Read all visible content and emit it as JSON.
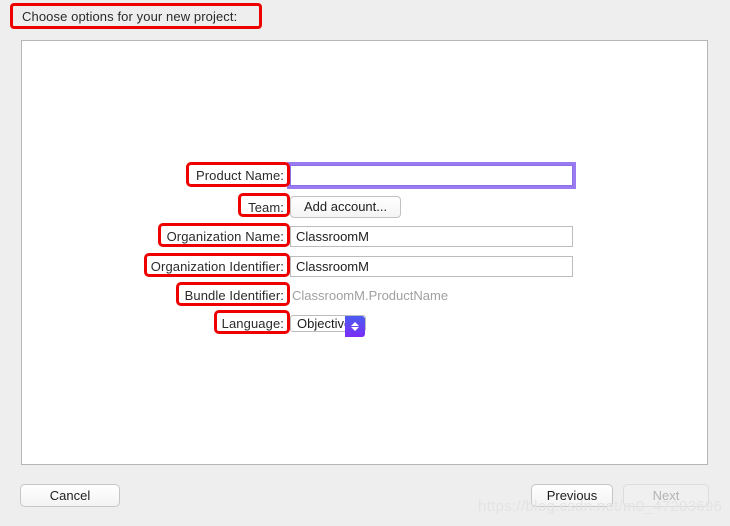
{
  "dialog": {
    "title": "Choose options for your new project:"
  },
  "form": {
    "rows": [
      {
        "label": "Product Name:",
        "type": "text",
        "value": "",
        "placeholder": "",
        "focused": true
      },
      {
        "label": "Team:",
        "type": "button",
        "value": "Add account..."
      },
      {
        "label": "Organization Name:",
        "type": "text",
        "value": "ClassroomM",
        "placeholder": "",
        "focused": false
      },
      {
        "label": "Organization Identifier:",
        "type": "text",
        "value": "ClassroomM",
        "placeholder": "",
        "focused": false
      },
      {
        "label": "Bundle Identifier:",
        "type": "static",
        "value": "ClassroomM.ProductName"
      },
      {
        "label": "Language:",
        "type": "popup",
        "value": "Objective-C",
        "stepper_icon": "stepper-up-down-icon"
      }
    ]
  },
  "footer": {
    "cancel_label": "Cancel",
    "previous_label": "Previous",
    "next_label": "Next",
    "next_disabled": true
  },
  "watermark": {
    "text": "https://blog.csdn.net/m0_47203696"
  },
  "colors": {
    "annotation": "#ef0000",
    "focus_ring": "#9a7af0",
    "stepper_start": "#4a5cf0",
    "stepper_end": "#7b2cf5",
    "panel_background": "#ffffff",
    "window_background": "#eeeeee"
  }
}
